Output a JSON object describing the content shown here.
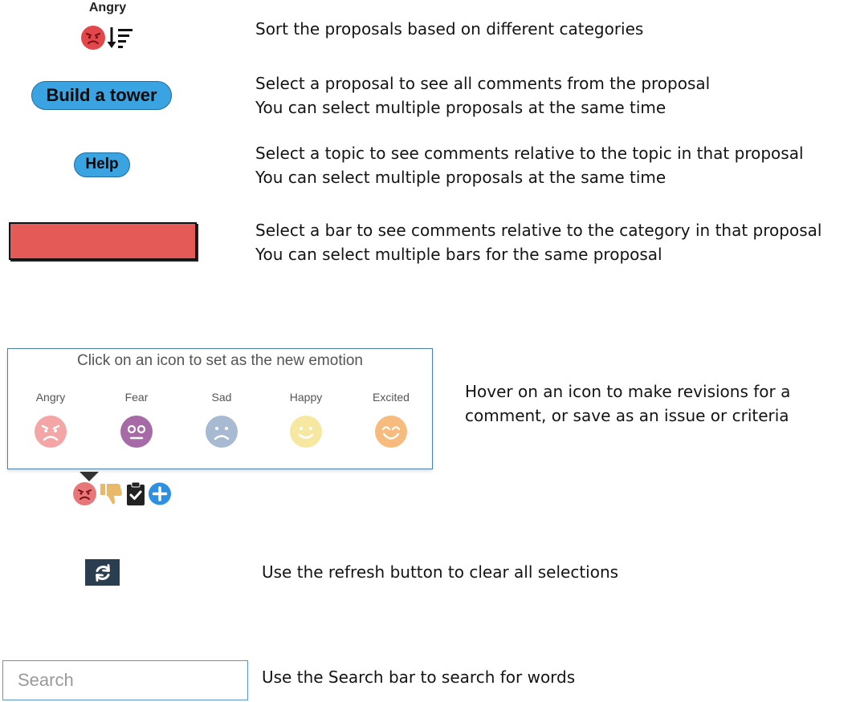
{
  "sort": {
    "label": "Angry",
    "description": [
      "Sort the proposals based on different categories"
    ]
  },
  "proposal": {
    "label": "Build a tower",
    "description": [
      "Select a proposal to see all comments from the proposal",
      "You can select multiple proposals at the same time"
    ]
  },
  "topic": {
    "label": "Help",
    "description": [
      "Select a topic to see comments relative to the topic in that proposal",
      "You can select multiple proposals at the same time"
    ]
  },
  "bar": {
    "color": "#e45a56",
    "description": [
      "Select a bar to see comments relative to the category in that proposal",
      "You can select multiple bars for the same proposal"
    ]
  },
  "emotion_panel": {
    "title": "Click on an icon to set as the new emotion",
    "emotions": [
      {
        "name": "Angry",
        "color": "#f4a6a6"
      },
      {
        "name": "Fear",
        "color": "#a66aa6"
      },
      {
        "name": "Sad",
        "color": "#a8b9d2"
      },
      {
        "name": "Happy",
        "color": "#f6e8a0"
      },
      {
        "name": "Excited",
        "color": "#f7bb7e"
      }
    ],
    "description": [
      "Hover on an icon to make revisions for a",
      "comment, or save as an issue or criteria"
    ]
  },
  "comment_actions": {
    "icons": [
      "angry-face-icon",
      "thumbs-down-icon",
      "clipboard-check-icon",
      "plus-circle-icon"
    ]
  },
  "refresh": {
    "icon": "refresh-icon",
    "description": [
      "Use the refresh button to clear all selections"
    ]
  },
  "search": {
    "placeholder": "Search",
    "description": [
      "Use the Search bar to search for words"
    ]
  }
}
